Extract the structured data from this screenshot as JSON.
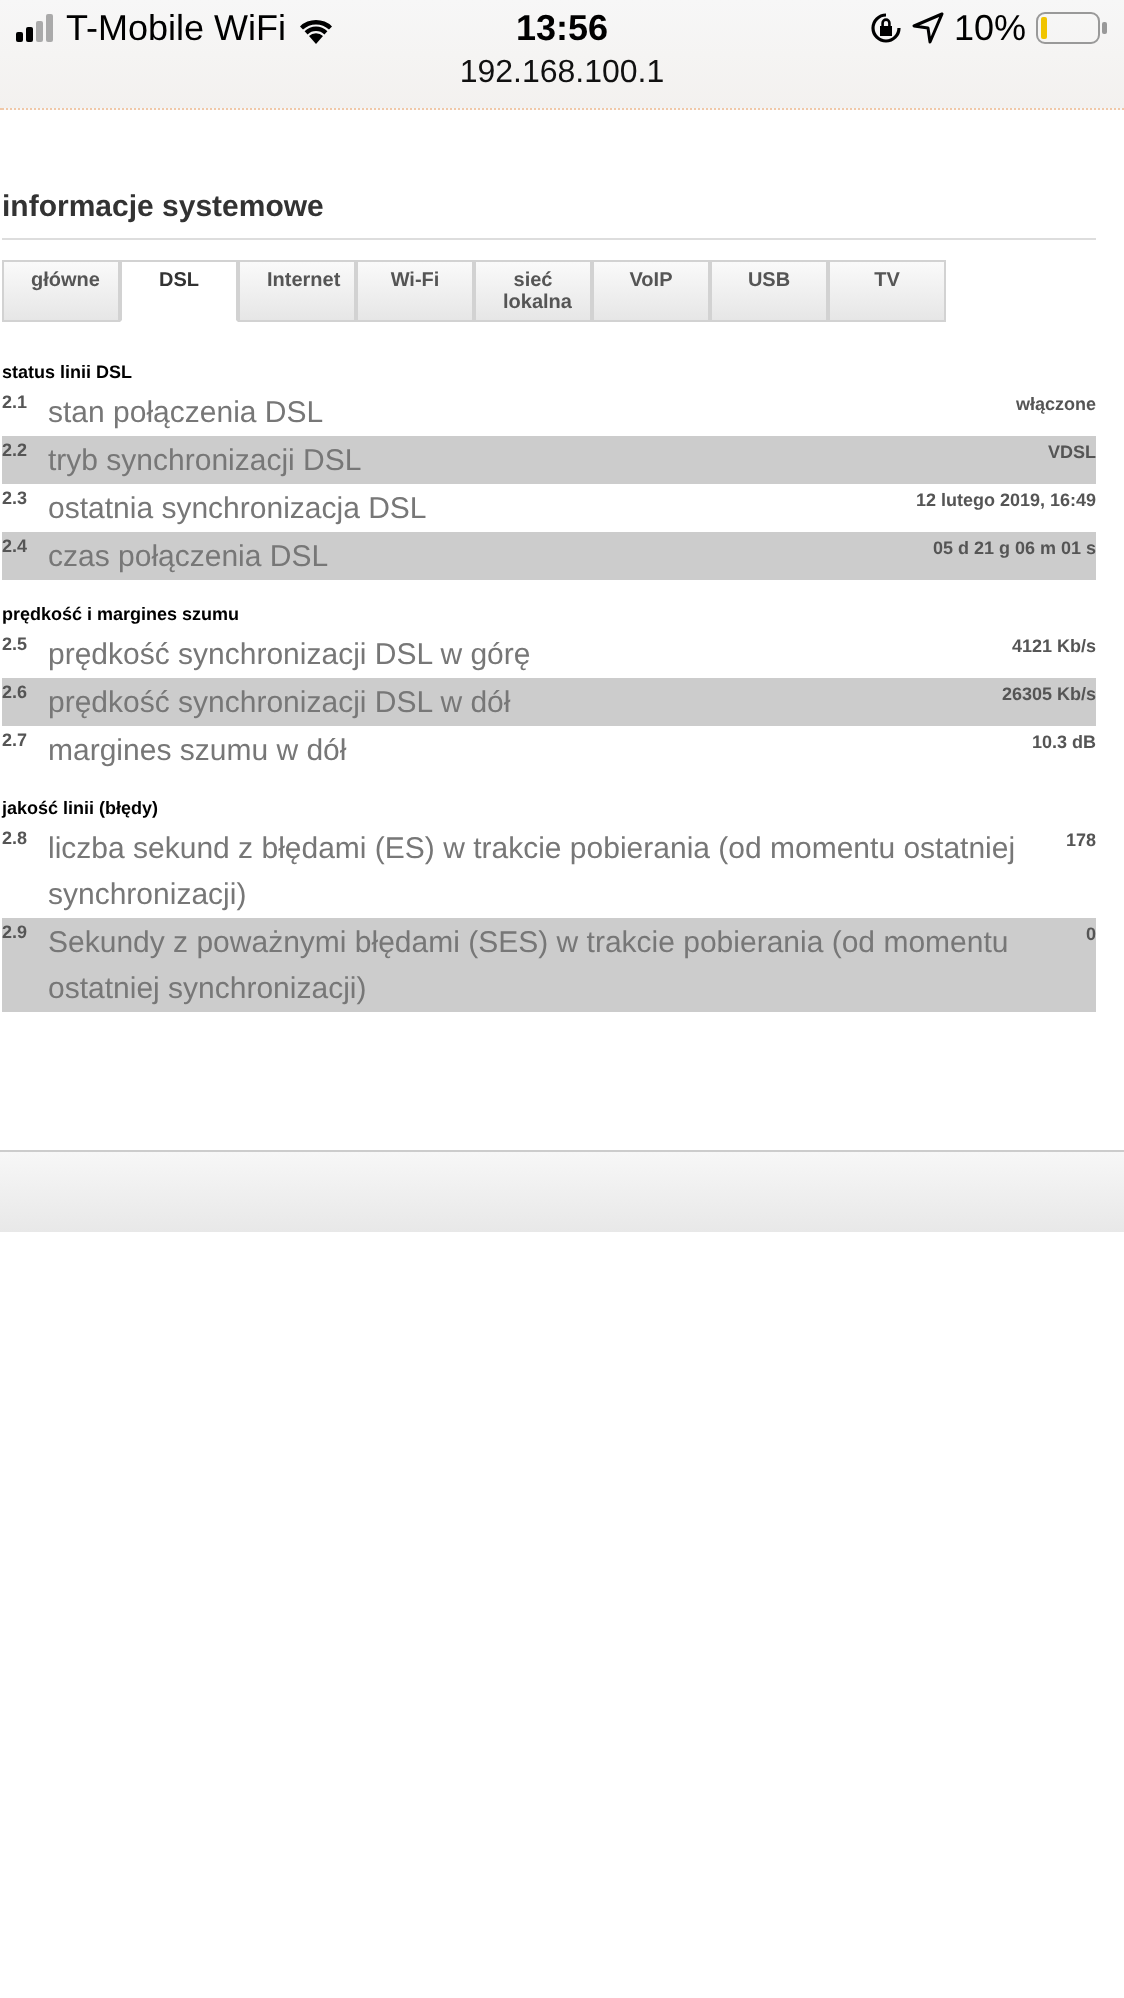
{
  "status_bar": {
    "carrier": "T-Mobile WiFi",
    "time": "13:56",
    "battery": "10%"
  },
  "address_bar": {
    "url": "192.168.100.1"
  },
  "page_title": "informacje systemowe",
  "tabs": [
    {
      "label": "główne",
      "selected": false
    },
    {
      "label": "DSL",
      "selected": true
    },
    {
      "label": "Internet",
      "selected": false
    },
    {
      "label": "Wi-Fi",
      "selected": false
    },
    {
      "label": "sieć lokalna",
      "selected": false
    },
    {
      "label": "VoIP",
      "selected": false
    },
    {
      "label": "USB",
      "selected": false
    },
    {
      "label": "TV",
      "selected": false
    }
  ],
  "sections": [
    {
      "heading": "status linii DSL",
      "rows": [
        {
          "number": "2.1",
          "label": "stan połączenia DSL",
          "value": "włączone"
        },
        {
          "number": "2.2",
          "label": "tryb synchronizacji DSL",
          "value": "VDSL"
        },
        {
          "number": "2.3",
          "label": "ostatnia synchronizacja DSL",
          "value": "12 lutego 2019, 16:49"
        },
        {
          "number": "2.4",
          "label": "czas połączenia DSL",
          "value": "05 d 21 g 06 m 01 s"
        }
      ]
    },
    {
      "heading": "prędkość i margines szumu",
      "rows": [
        {
          "number": "2.5",
          "label": "prędkość synchronizacji DSL w górę",
          "value": "4121 Kb/s"
        },
        {
          "number": "2.6",
          "label": "prędkość synchronizacji DSL w dół",
          "value": "26305 Kb/s"
        },
        {
          "number": "2.7",
          "label": "margines szumu w dół",
          "value": "10.3 dB"
        }
      ]
    },
    {
      "heading": "jakość linii (błędy)",
      "rows": [
        {
          "number": "2.8",
          "label": "liczba sekund z błędami (ES) w trakcie pobierania (od momentu ostatniej synchronizacji)",
          "value": "178"
        },
        {
          "number": "2.9",
          "label": "Sekundy z poważnymi błędami (SES) w trakcie pobierania (od momentu ostatniej synchronizacji)",
          "value": "0"
        }
      ]
    }
  ]
}
